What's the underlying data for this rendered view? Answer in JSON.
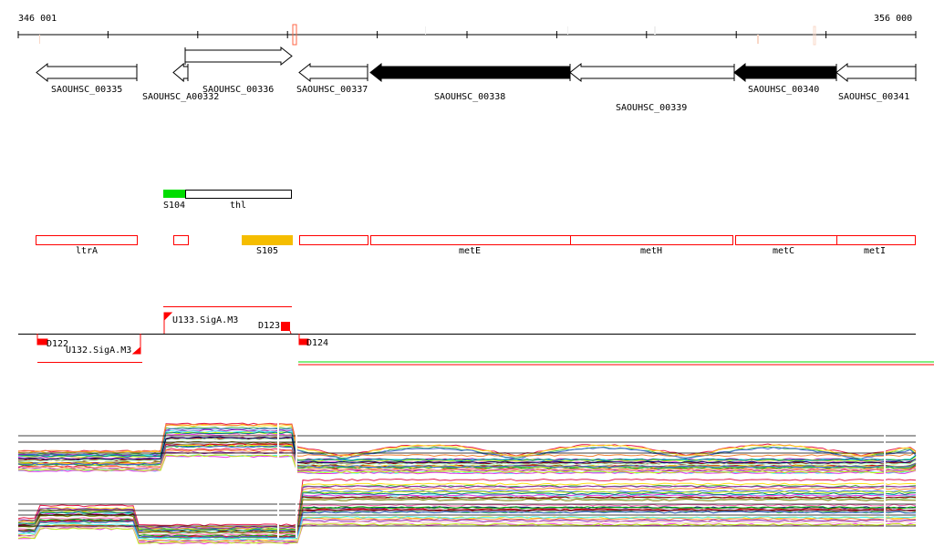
{
  "ruler": {
    "start_label": "346 001",
    "end_label": "356 000"
  },
  "genes": [
    {
      "name": "SAOUHSC_00335",
      "strand": "-",
      "fill": "white"
    },
    {
      "name": "SAOUHSC_A00332",
      "strand": "-",
      "fill": "white"
    },
    {
      "name": "SAOUHSC_00336",
      "strand": "+",
      "fill": "white"
    },
    {
      "name": "SAOUHSC_00337",
      "strand": "-",
      "fill": "white"
    },
    {
      "name": "SAOUHSC_00338",
      "strand": "-",
      "fill": "black"
    },
    {
      "name": "SAOUHSC_00339",
      "strand": "-",
      "fill": "white"
    },
    {
      "name": "SAOUHSC_00340",
      "strand": "-",
      "fill": "black"
    },
    {
      "name": "SAOUHSC_00341",
      "strand": "-",
      "fill": "white"
    }
  ],
  "features": {
    "s104": "S104",
    "thl": "thl",
    "ltrA": "ltrA",
    "s105": "S105",
    "metE": "metE",
    "metH": "metH",
    "metC": "metC",
    "metI": "metI"
  },
  "promoters": {
    "d122": "D122",
    "u132": "U132.SigA.M3",
    "u133": "U133.SigA.M3",
    "d123": "D123",
    "d124": "D124"
  },
  "colors": {
    "red": "#ff0000",
    "green": "#00dd00",
    "orange": "#f5bd00",
    "marker": "#ff6644"
  }
}
